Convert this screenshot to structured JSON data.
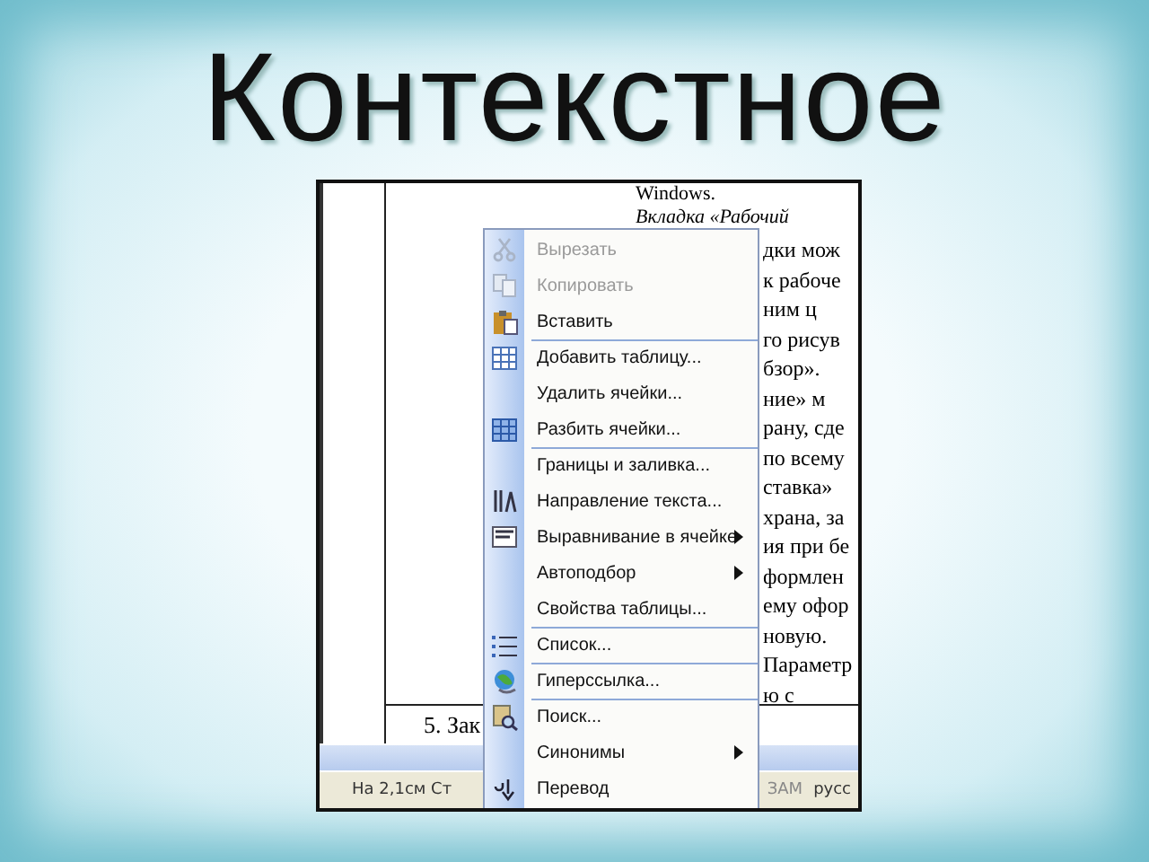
{
  "slide": {
    "title": "Контекстное"
  },
  "document": {
    "lines_above": [
      "Windows.",
      "Вкладка «Рабочий"
    ],
    "lines_right": [
      "дки мож",
      "к рабоче",
      "ним ц",
      "го рисув",
      "бзор».",
      "ние» м",
      "рану, сде",
      "по всему",
      "ставка»",
      "храна, за",
      "ия при бе",
      "формлен",
      "ему офор",
      "новую.",
      "Параметр",
      "ю с"
    ],
    "table_cell": "5. Зак"
  },
  "status_bar": {
    "position": "На 2,1см Ст",
    "mode": "ЗАМ",
    "language": "русс"
  },
  "context_menu": {
    "items": [
      {
        "label": "Вырезать",
        "disabled": true,
        "submenu": false,
        "separator_above": false
      },
      {
        "label": "Копировать",
        "disabled": true,
        "submenu": false,
        "separator_above": false
      },
      {
        "label": "Вставить",
        "disabled": false,
        "submenu": false,
        "separator_above": false
      },
      {
        "label": "Добавить таблицу...",
        "disabled": false,
        "submenu": false,
        "separator_above": true
      },
      {
        "label": "Удалить ячейки...",
        "disabled": false,
        "submenu": false,
        "separator_above": false
      },
      {
        "label": "Разбить ячейки...",
        "disabled": false,
        "submenu": false,
        "separator_above": false
      },
      {
        "label": "Границы и заливка...",
        "disabled": false,
        "submenu": false,
        "separator_above": true
      },
      {
        "label": "Направление текста...",
        "disabled": false,
        "submenu": false,
        "separator_above": false
      },
      {
        "label": "Выравнивание в ячейке",
        "disabled": false,
        "submenu": true,
        "separator_above": false
      },
      {
        "label": "Автоподбор",
        "disabled": false,
        "submenu": true,
        "separator_above": false
      },
      {
        "label": "Свойства таблицы...",
        "disabled": false,
        "submenu": false,
        "separator_above": false
      },
      {
        "label": "Список...",
        "disabled": false,
        "submenu": false,
        "separator_above": true
      },
      {
        "label": "Гиперссылка...",
        "disabled": false,
        "submenu": false,
        "separator_above": true
      },
      {
        "label": "Поиск...",
        "disabled": false,
        "submenu": false,
        "separator_above": true
      },
      {
        "label": "Синонимы",
        "disabled": false,
        "submenu": true,
        "separator_above": false
      },
      {
        "label": "Перевод",
        "disabled": false,
        "submenu": false,
        "separator_above": false
      }
    ]
  }
}
